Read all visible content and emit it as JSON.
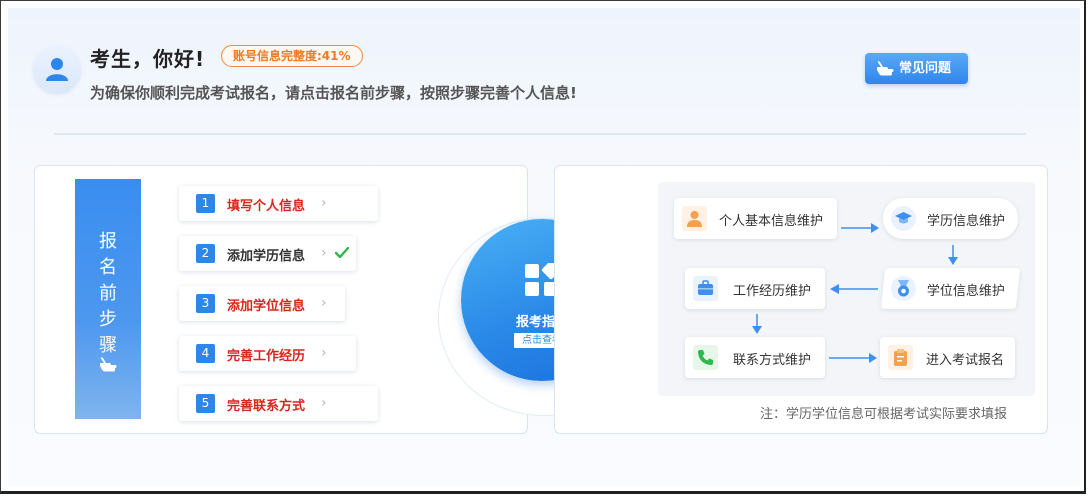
{
  "header": {
    "greeting": "考生，你好!",
    "completeness_badge": "账号信息完整度:41%",
    "subtitle": "为确保你顺利完成考试报名，请点击报名前步骤，按照步骤完善个人信息!",
    "faq_button": "常见问题"
  },
  "steps_panel": {
    "banner_text": "报名前步骤",
    "steps": [
      {
        "num": "1",
        "label": "填写个人信息",
        "status": "incomplete",
        "color": "#d9251c"
      },
      {
        "num": "2",
        "label": "添加学历信息",
        "status": "complete",
        "color": "#333333"
      },
      {
        "num": "3",
        "label": "添加学位信息",
        "status": "incomplete",
        "color": "#d9251c"
      },
      {
        "num": "4",
        "label": "完善工作经历",
        "status": "incomplete",
        "color": "#d9251c"
      },
      {
        "num": "5",
        "label": "完善联系方式",
        "status": "incomplete",
        "color": "#d9251c"
      }
    ]
  },
  "guide": {
    "title": "报考指南",
    "link": "点击查看"
  },
  "flow": {
    "nodes": [
      {
        "label": "个人基本信息维护",
        "icon": "person-icon"
      },
      {
        "label": "学历信息维护",
        "icon": "graduation-cap-icon"
      },
      {
        "label": "学位信息维护",
        "icon": "medal-icon"
      },
      {
        "label": "工作经历维护",
        "icon": "briefcase-icon"
      },
      {
        "label": "联系方式维护",
        "icon": "phone-icon"
      },
      {
        "label": "进入考试报名",
        "icon": "clipboard-icon"
      }
    ],
    "note": "注：学历学位信息可根据考试实际要求填报"
  },
  "colors": {
    "accent": "#2f86ea",
    "warning": "#ef7a22",
    "alert_text": "#d9251c",
    "check": "#2db84d"
  }
}
